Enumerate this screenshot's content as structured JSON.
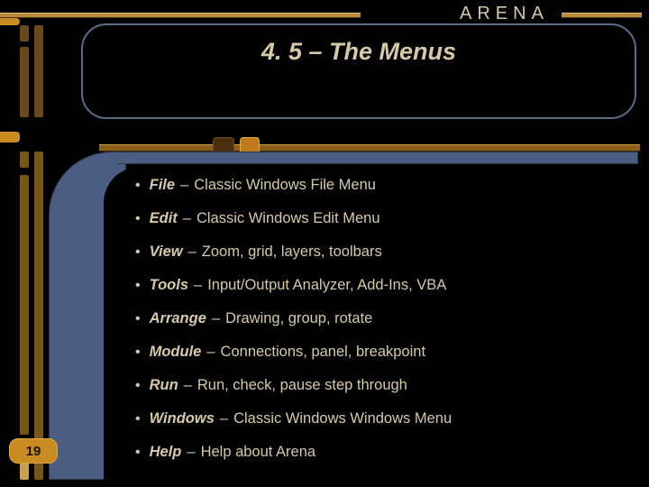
{
  "header": {
    "brand": "ARENA"
  },
  "title": "4. 5 – The Menus",
  "page_number": "19",
  "menus": [
    {
      "name": "File",
      "desc": "Classic Windows File Menu"
    },
    {
      "name": "Edit",
      "desc": "Classic Windows Edit Menu"
    },
    {
      "name": "View",
      "desc": "Zoom, grid, layers, toolbars"
    },
    {
      "name": "Tools",
      "desc": "Input/Output Analyzer, Add-Ins, VBA"
    },
    {
      "name": "Arrange",
      "desc": "Drawing, group, rotate"
    },
    {
      "name": "Module",
      "desc": "Connections, panel, breakpoint"
    },
    {
      "name": "Run",
      "desc": "Run, check, pause step through"
    },
    {
      "name": "Windows",
      "desc": "Classic Windows Windows Menu"
    },
    {
      "name": "Help",
      "desc": "Help about Arena"
    }
  ]
}
